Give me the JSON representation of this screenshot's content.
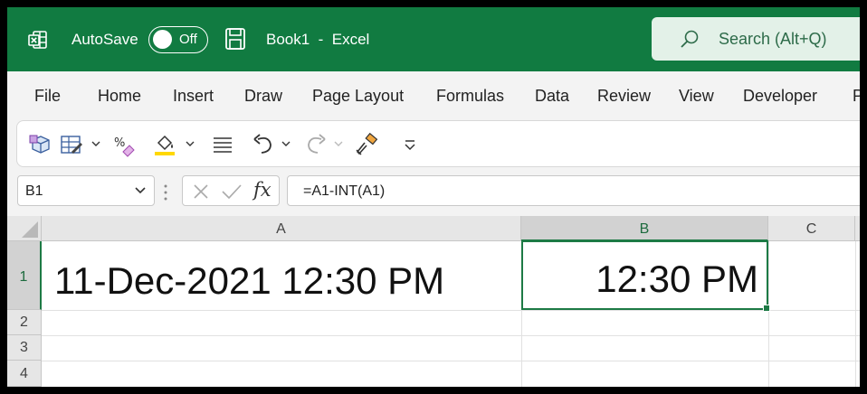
{
  "titlebar": {
    "autosave_label": "AutoSave",
    "autosave_state": "Off",
    "document_title": "Book1  -  Excel",
    "search_placeholder": "Search (Alt+Q)",
    "brand_color": "#117b41"
  },
  "menu": {
    "tabs": [
      "File",
      "Home",
      "Insert",
      "Draw",
      "Page Layout",
      "Formulas",
      "Data",
      "Review",
      "View",
      "Developer",
      "P"
    ]
  },
  "ribbon": {
    "icons": [
      "3d-cube-icon",
      "format-table-icon",
      "percent-style-icon",
      "fill-color-icon",
      "align-icon",
      "undo-icon",
      "redo-icon",
      "format-painter-icon",
      "customize-toolbar-icon"
    ],
    "fill_color": "#ffd800"
  },
  "formula_bar": {
    "name_box": "B1",
    "fx_label": "fx",
    "formula": "=A1-INT(A1)"
  },
  "grid": {
    "columns": [
      "A",
      "B",
      "C"
    ],
    "rows": [
      "1",
      "2",
      "3",
      "4"
    ],
    "cells": {
      "A1": "11-Dec-2021 12:30 PM",
      "B1": "12:30 PM"
    },
    "selected_cell": "B1",
    "selection_color": "#1d7a45"
  }
}
